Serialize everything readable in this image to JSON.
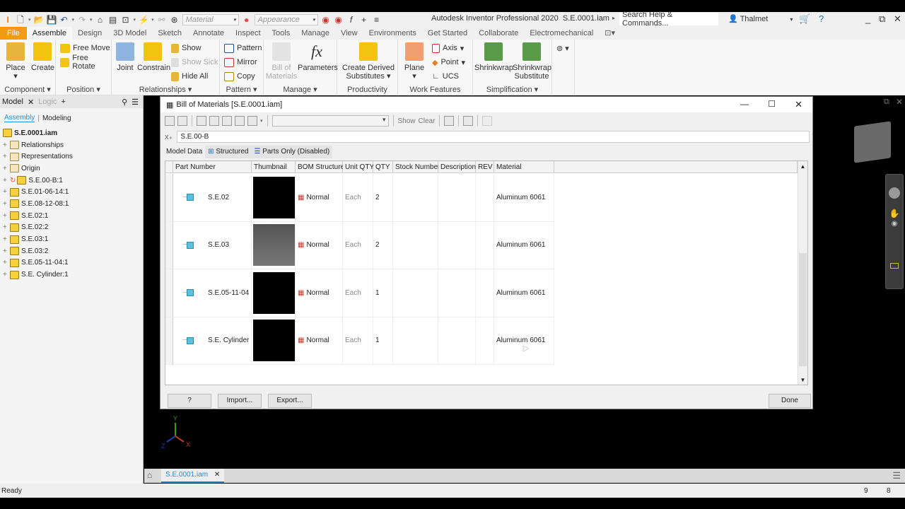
{
  "titlebar": {
    "app_title": "Autodesk Inventor Professional 2020",
    "document": "S.E.0001.iam",
    "material_placeholder": "Material",
    "appearance_placeholder": "Appearance",
    "search_placeholder": "Search Help & Commands...",
    "user": "Thalmet"
  },
  "ribbon_tabs": [
    "File",
    "Assemble",
    "Design",
    "3D Model",
    "Sketch",
    "Annotate",
    "Inspect",
    "Tools",
    "Manage",
    "View",
    "Environments",
    "Get Started",
    "Collaborate",
    "Electromechanical"
  ],
  "ribbon": {
    "component": {
      "title": "Component",
      "place": "Place",
      "create": "Create"
    },
    "position": {
      "title": "Position",
      "free_move": "Free Move",
      "free_rotate": "Free Rotate"
    },
    "relationships": {
      "title": "Relationships",
      "joint": "Joint",
      "constrain": "Constrain",
      "show": "Show",
      "show_sick": "Show Sick",
      "hide_all": "Hide All"
    },
    "pattern": {
      "title": "Pattern",
      "pattern": "Pattern",
      "mirror": "Mirror",
      "copy": "Copy"
    },
    "manage": {
      "title": "Manage",
      "bom": "Bill of Materials",
      "parameters": "Parameters"
    },
    "productivity": {
      "title": "Productivity",
      "derived": "Create Derived Substitutes"
    },
    "work_features": {
      "title": "Work Features",
      "plane": "Plane",
      "axis": "Axis",
      "point": "Point",
      "ucs": "UCS"
    },
    "simplification": {
      "title": "Simplification",
      "shrinkwrap": "Shrinkwrap",
      "shrinkwrap_sub": "Shrinkwrap Substitute"
    }
  },
  "browser": {
    "tab_model": "Model",
    "tab_logic": "Logic",
    "mode_assembly": "Assembly",
    "mode_modeling": "Modeling",
    "root": "S.E.0001.iam",
    "items": [
      "Relationships",
      "Representations",
      "Origin",
      "S.E.00-B:1",
      "S.E.01-06-14:1",
      "S.E.08-12-08:1",
      "S.E.02:1",
      "S.E.02:2",
      "S.E.03:1",
      "S.E.03:2",
      "S.E.05-11-04:1",
      "S.E. Cylinder:1"
    ]
  },
  "dialog": {
    "title": "Bill of Materials [S.E.0001.iam]",
    "show": "Show",
    "clear": "Clear",
    "path": "S.E.00-B",
    "tabs": [
      "Model Data",
      "Structured",
      "Parts Only (Disabled)"
    ],
    "columns": [
      "Part Number",
      "Thumbnail",
      "BOM Structure",
      "Unit QTY",
      "QTY",
      "Stock Number",
      "Description",
      "REV",
      "Material"
    ],
    "rows": [
      {
        "part": "S.E.02",
        "bom": "Normal",
        "unit": "Each",
        "qty": "2",
        "stock": "",
        "desc": "",
        "rev": "",
        "material": "Aluminum 6061"
      },
      {
        "part": "S.E.03",
        "bom": "Normal",
        "unit": "Each",
        "qty": "2",
        "stock": "",
        "desc": "",
        "rev": "",
        "material": "Aluminum 6061"
      },
      {
        "part": "S.E.05-11-04",
        "bom": "Normal",
        "unit": "Each",
        "qty": "1",
        "stock": "",
        "desc": "",
        "rev": "",
        "material": "Aluminum 6061"
      },
      {
        "part": "S.E. Cylinder",
        "bom": "Normal",
        "unit": "Each",
        "qty": "1",
        "stock": "",
        "desc": "",
        "rev": "",
        "material": "Aluminum 6061"
      }
    ],
    "help": "?",
    "import": "Import...",
    "export": "Export...",
    "done": "Done"
  },
  "doc_tab": "S.E.0001.iam",
  "status": {
    "text": "Ready",
    "n1": "9",
    "n2": "8"
  },
  "axes": {
    "x": "X",
    "y": "Y",
    "z": "Z"
  }
}
